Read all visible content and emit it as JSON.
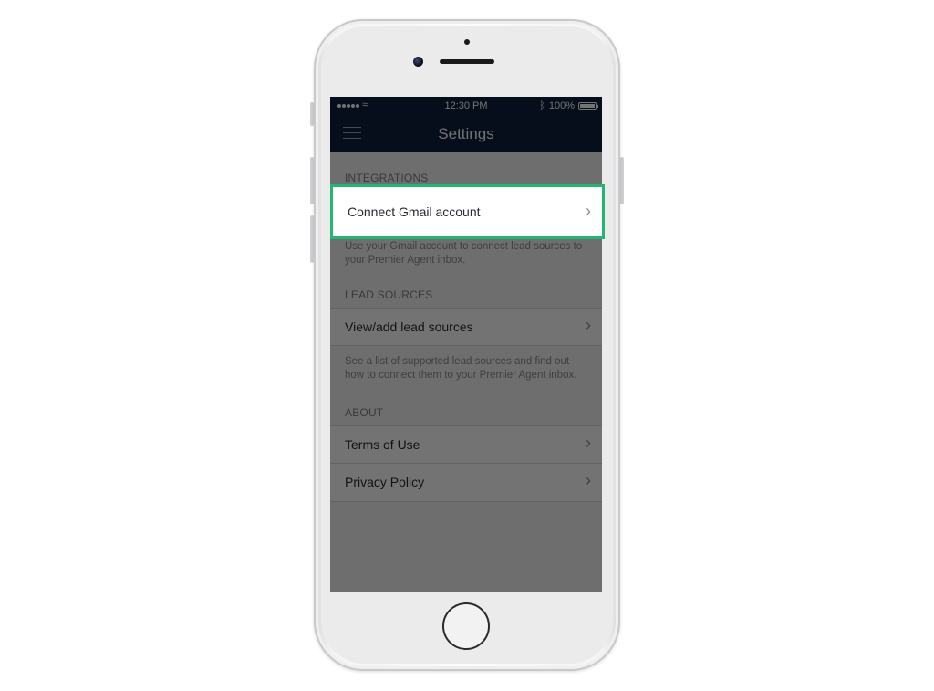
{
  "status_bar": {
    "time": "12:30 PM",
    "battery": "100%",
    "bluetooth_icon": "ᛒ",
    "wifi_icon": "wifi-icon"
  },
  "nav": {
    "title": "Settings"
  },
  "sections": {
    "integrations": {
      "header": "INTEGRATIONS",
      "row_label": "Connect Gmail account",
      "footer": "Use your Gmail account to connect lead sources to your Premier Agent inbox."
    },
    "lead_sources": {
      "header": "LEAD SOURCES",
      "row_label": "View/add lead sources",
      "footer": "See a list of supported lead sources and find out how to connect them to your Premier Agent inbox."
    },
    "about": {
      "header": "ABOUT",
      "rows": [
        "Terms of Use",
        "Privacy Policy"
      ]
    }
  },
  "chevron": "›",
  "colors": {
    "nav_background": "#0d1f3a",
    "highlight_border": "#22b573",
    "overlay": "rgba(0,0,0,0.55)"
  }
}
